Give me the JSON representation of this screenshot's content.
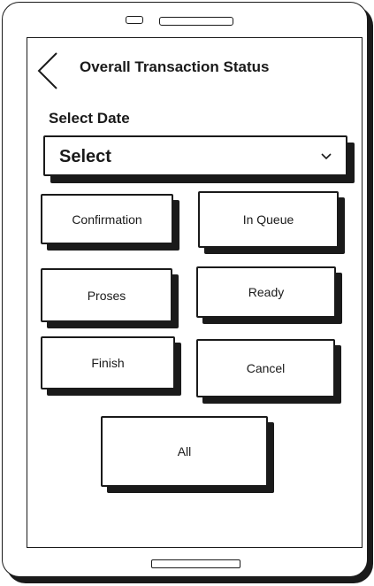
{
  "header": {
    "back_icon": "chevron-left-icon",
    "title": "Overall Transaction Status"
  },
  "date_filter": {
    "label": "Select Date",
    "value": "Select",
    "chevron_icon": "chevron-down-icon"
  },
  "statuses": {
    "confirmation": "Confirmation",
    "in_queue": "In Queue",
    "proses": "Proses",
    "ready": "Ready",
    "finish": "Finish",
    "cancel": "Cancel",
    "all": "All"
  },
  "colors": {
    "ink": "#1a1a1a",
    "background": "#ffffff"
  }
}
